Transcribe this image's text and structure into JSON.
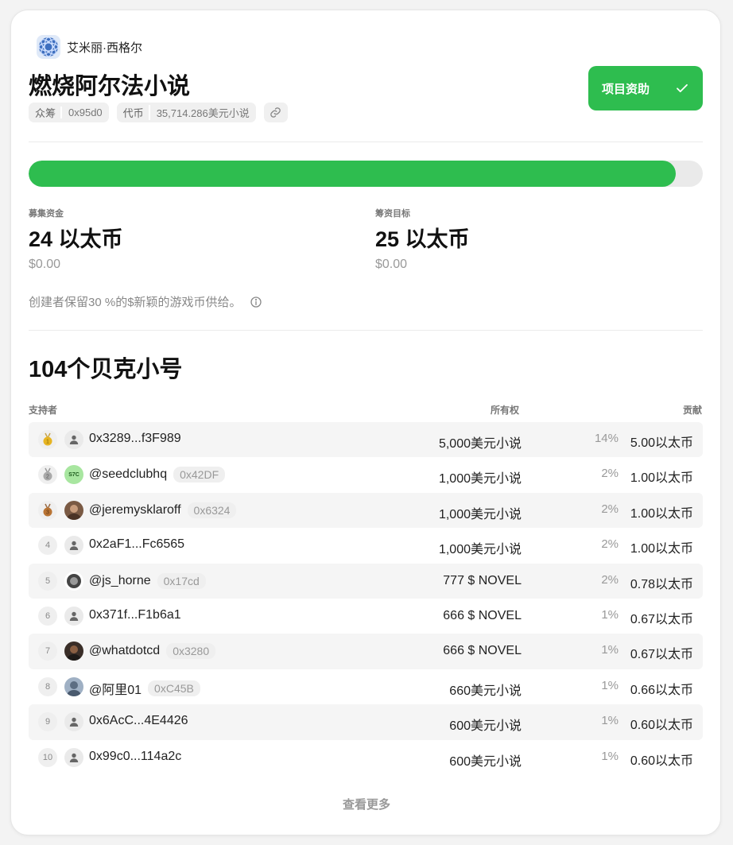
{
  "creator": {
    "name": "艾米丽·西格尔"
  },
  "project": {
    "title": "燃烧阿尔法小说",
    "tags": [
      {
        "key": "众筹",
        "value": "0x95d0"
      },
      {
        "key": "代币",
        "value": "35,714.286美元小说"
      }
    ],
    "fund_button_label": "项目资助"
  },
  "progress": {
    "fraction": 0.96
  },
  "stats": {
    "raised": {
      "label": "募集资金",
      "value": "24 以太币",
      "usd": "$0.00"
    },
    "goal": {
      "label": "筹资目标",
      "value": "25 以太币",
      "usd": "$0.00"
    }
  },
  "note": "创建者保留30 %的$新颖的游戏币供给。",
  "backers": {
    "title": "104个贝克小号",
    "headers": {
      "backer": "支持者",
      "ownership": "所有权",
      "contribution": "贡献"
    },
    "rows": [
      {
        "rank": "1",
        "name": "0x3289...f3F989",
        "badge": "",
        "ownership": "5,000美元小说",
        "pct": "14%",
        "contribution": "5.00以太币"
      },
      {
        "rank": "2",
        "name": "@seedclubhq",
        "badge": "0x42DF",
        "ownership": "1,000美元小说",
        "pct": "2%",
        "contribution": "1.00以太币"
      },
      {
        "rank": "3",
        "name": "@jeremysklaroff",
        "badge": "0x6324",
        "ownership": "1,000美元小说",
        "pct": "2%",
        "contribution": "1.00以太币"
      },
      {
        "rank": "4",
        "name": "0x2aF1...Fc6565",
        "badge": "",
        "ownership": "1,000美元小说",
        "pct": "2%",
        "contribution": "1.00以太币"
      },
      {
        "rank": "5",
        "name": "@js_horne",
        "badge": "0x17cd",
        "ownership": "777 $ NOVEL",
        "pct": "2%",
        "contribution": "0.78以太币"
      },
      {
        "rank": "6",
        "name": "0x371f...F1b6a1",
        "badge": "",
        "ownership": "666 $ NOVEL",
        "pct": "1%",
        "contribution": "0.67以太币"
      },
      {
        "rank": "7",
        "name": "@whatdotcd",
        "badge": "0x3280",
        "ownership": "666 $ NOVEL",
        "pct": "1%",
        "contribution": "0.67以太币"
      },
      {
        "rank": "8",
        "name": "@阿里01",
        "badge": "0xC45B",
        "ownership": "660美元小说",
        "pct": "1%",
        "contribution": "0.66以太币"
      },
      {
        "rank": "9",
        "name": "0x6AcC...4E4426",
        "badge": "",
        "ownership": "600美元小说",
        "pct": "1%",
        "contribution": "0.60以太币"
      },
      {
        "rank": "10",
        "name": "0x99c0...114a2c",
        "badge": "",
        "ownership": "600美元小说",
        "pct": "1%",
        "contribution": "0.60以太币"
      }
    ],
    "avatar_texts": {
      "seedclub": "S7C"
    }
  },
  "view_more_label": "查看更多",
  "colors": {
    "accent": "#2ebd4f",
    "gold": "#e6b422",
    "silver": "#a9a9a9",
    "bronze": "#b87333"
  }
}
